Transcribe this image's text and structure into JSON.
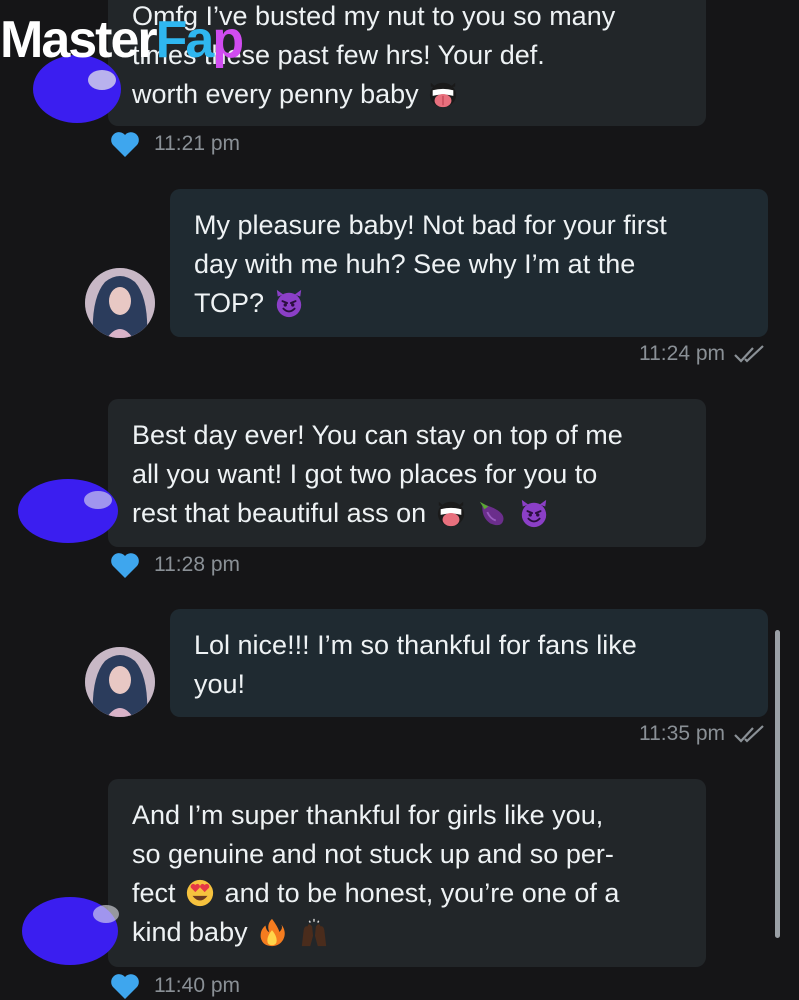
{
  "watermark": {
    "part1": "Master",
    "part2": "Fa",
    "part3": "p"
  },
  "messages": [
    {
      "direction": "incoming",
      "lines": [
        "Omfg I’ve busted my nut to you so many",
        "times these past few hrs! Your def.",
        "worth every penny baby"
      ],
      "emoji": [
        "tongue-face"
      ],
      "time": "11:21 pm",
      "status_icon": "heart-icon"
    },
    {
      "direction": "outgoing",
      "lines": [
        "My pleasure baby! Not bad for your first",
        "day with me huh? See why I’m at the",
        "TOP?"
      ],
      "emoji": [
        "smiling-devil"
      ],
      "time": "11:24 pm",
      "status_icon": "double-check-icon"
    },
    {
      "direction": "incoming",
      "lines": [
        "Best day ever! You can stay on top of me",
        "all you want! I got two places for you to",
        "rest that beautiful ass on"
      ],
      "emoji": [
        "tongue-face",
        "eggplant",
        "smiling-devil"
      ],
      "time": "11:28 pm",
      "status_icon": "heart-icon"
    },
    {
      "direction": "outgoing",
      "lines": [
        "Lol nice!!! I’m so thankful for fans like",
        "you!"
      ],
      "emoji": [],
      "time": "11:35 pm",
      "status_icon": "double-check-icon"
    },
    {
      "direction": "incoming",
      "lines": [
        "And I’m super thankful for girls like you,",
        "so genuine and not stuck up and so per-",
        "fect",
        "and to be honest, you’re one of a",
        "kind baby"
      ],
      "emoji": [
        "heart-eyes",
        "fire",
        "raising-hands"
      ],
      "time": "11:40 pm",
      "status_icon": "heart-icon"
    }
  ],
  "colors": {
    "background": "#151517",
    "bubble_incoming": "#222629",
    "bubble_outgoing": "#1f2a31",
    "heart": "#3ea6ee",
    "redaction": "#3b1ef0",
    "timestamp": "#8a9096"
  }
}
